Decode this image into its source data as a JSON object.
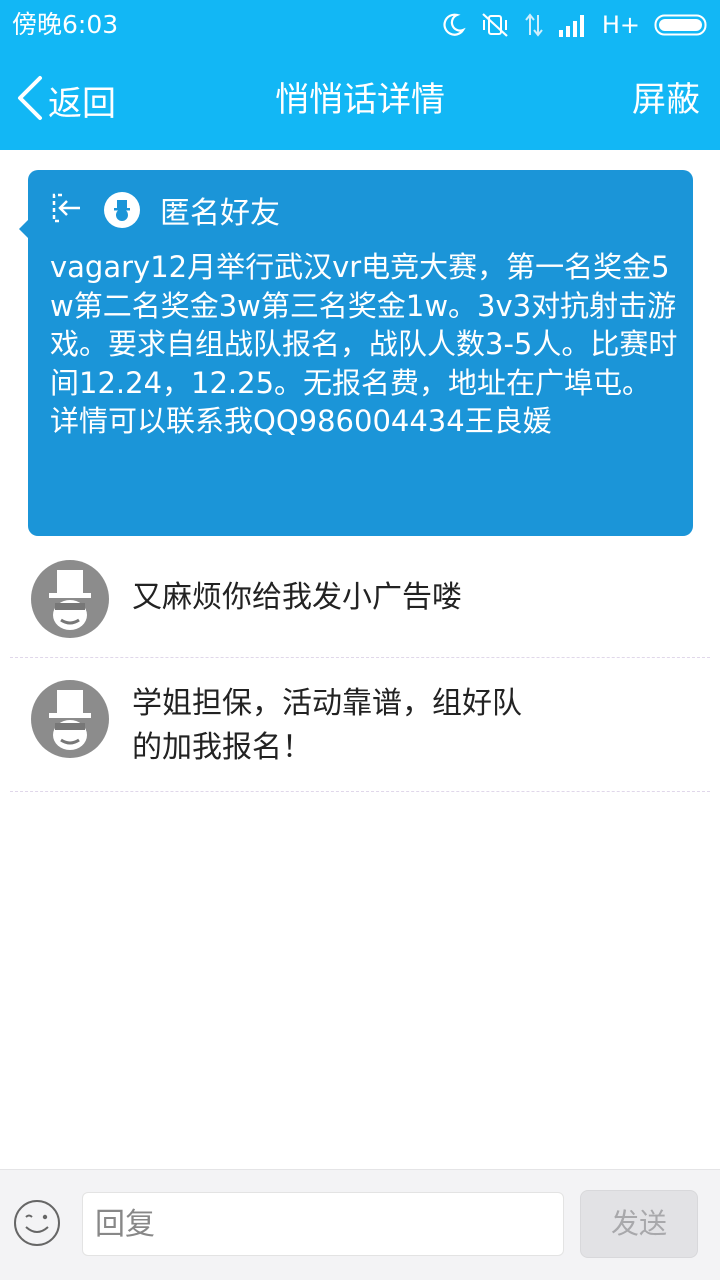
{
  "status_bar": {
    "time": "傍晚6:03",
    "network": "H+"
  },
  "header": {
    "back_label": "返回",
    "title": "悄悄话详情",
    "block_label": "屏蔽"
  },
  "post": {
    "author": "匿名好友",
    "content": "vagary12月举行武汉vr电竞大赛，第一名奖金5w第二名奖金3w第三名奖金1w。3v3对抗射击游戏。要求自组战队报名，战队人数3-5人。比赛时间12.24，12.25。无报名费，地址在广埠屯。详情可以联系我QQ986004434王良媛"
  },
  "comments": [
    {
      "text": "又麻烦你给我发小广告喽"
    },
    {
      "line1": "学姐担保，活动靠谱，组好队",
      "line2": "的加我报名！"
    }
  ],
  "input_bar": {
    "placeholder": "回复",
    "send_label": "发送"
  },
  "colors": {
    "header_bg": "#12b7f5",
    "card_bg": "#1b95d8",
    "avatar_gray": "#8c8c8c"
  }
}
